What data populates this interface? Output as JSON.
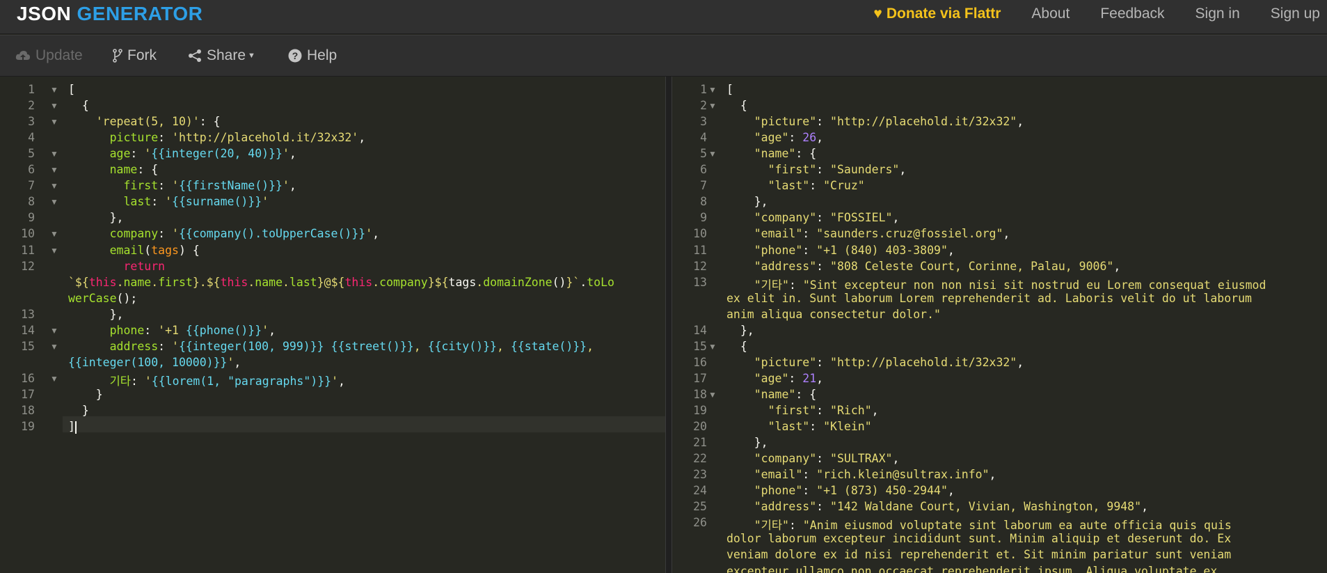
{
  "brand": {
    "part1": "JSON",
    "part2": "GENERATOR"
  },
  "nav": {
    "donate": "Donate via Flattr",
    "about": "About",
    "feedback": "Feedback",
    "signin": "Sign in",
    "signup": "Sign up"
  },
  "toolbar": {
    "update": "Update",
    "fork": "Fork",
    "share": "Share",
    "help": "Help"
  },
  "template_editor": {
    "lines": [
      {
        "n": "1",
        "fold": true,
        "tokens": [
          [
            "w",
            "["
          ]
        ]
      },
      {
        "n": "2",
        "fold": true,
        "tokens": [
          [
            "w",
            "  {"
          ]
        ]
      },
      {
        "n": "3",
        "fold": true,
        "tokens": [
          [
            "w",
            "    "
          ],
          [
            "s",
            "'repeat(5, 10)'"
          ],
          [
            "w",
            ": {"
          ]
        ]
      },
      {
        "n": "4",
        "fold": false,
        "tokens": [
          [
            "w",
            "      "
          ],
          [
            "k",
            "picture"
          ],
          [
            "w",
            ": "
          ],
          [
            "s",
            "'http://placehold.it/32x32'"
          ],
          [
            "w",
            ","
          ]
        ]
      },
      {
        "n": "5",
        "fold": true,
        "tokens": [
          [
            "w",
            "      "
          ],
          [
            "k",
            "age"
          ],
          [
            "w",
            ": "
          ],
          [
            "s",
            "'"
          ],
          [
            "t",
            "{{integer(20, 40)}}"
          ],
          [
            "s",
            "'"
          ],
          [
            "w",
            ","
          ]
        ]
      },
      {
        "n": "6",
        "fold": true,
        "tokens": [
          [
            "w",
            "      "
          ],
          [
            "k",
            "name"
          ],
          [
            "w",
            ": {"
          ]
        ]
      },
      {
        "n": "7",
        "fold": true,
        "tokens": [
          [
            "w",
            "        "
          ],
          [
            "k",
            "first"
          ],
          [
            "w",
            ": "
          ],
          [
            "s",
            "'"
          ],
          [
            "t",
            "{{firstName()}}"
          ],
          [
            "s",
            "'"
          ],
          [
            "w",
            ","
          ]
        ]
      },
      {
        "n": "8",
        "fold": true,
        "tokens": [
          [
            "w",
            "        "
          ],
          [
            "k",
            "last"
          ],
          [
            "w",
            ": "
          ],
          [
            "s",
            "'"
          ],
          [
            "t",
            "{{surname()}}"
          ],
          [
            "s",
            "'"
          ]
        ]
      },
      {
        "n": "9",
        "fold": false,
        "tokens": [
          [
            "w",
            "      },"
          ]
        ]
      },
      {
        "n": "10",
        "fold": true,
        "tokens": [
          [
            "w",
            "      "
          ],
          [
            "k",
            "company"
          ],
          [
            "w",
            ": "
          ],
          [
            "s",
            "'"
          ],
          [
            "t",
            "{{company().toUpperCase()}}"
          ],
          [
            "s",
            "'"
          ],
          [
            "w",
            ","
          ]
        ]
      },
      {
        "n": "11",
        "fold": true,
        "tokens": [
          [
            "w",
            "      "
          ],
          [
            "k",
            "email"
          ],
          [
            "w",
            "("
          ],
          [
            "p",
            "tags"
          ],
          [
            "w",
            ") {"
          ]
        ]
      },
      {
        "n": "12",
        "fold": false,
        "tokens": [
          [
            "w",
            "        "
          ],
          [
            "kw",
            "return"
          ]
        ]
      },
      {
        "n": "",
        "fold": false,
        "tokens": [
          [
            "s",
            "`${"
          ],
          [
            "kw",
            "this"
          ],
          [
            "s",
            "."
          ],
          [
            "k",
            "name"
          ],
          [
            "s",
            "."
          ],
          [
            "k",
            "first"
          ],
          [
            "s",
            "}.${"
          ],
          [
            "kw",
            "this"
          ],
          [
            "s",
            "."
          ],
          [
            "k",
            "name"
          ],
          [
            "s",
            "."
          ],
          [
            "k",
            "last"
          ],
          [
            "s",
            "}@${"
          ],
          [
            "kw",
            "this"
          ],
          [
            "s",
            "."
          ],
          [
            "k",
            "company"
          ],
          [
            "s",
            "}${"
          ],
          [
            "w",
            "tags"
          ],
          [
            "s",
            "."
          ],
          [
            "k",
            "domainZone"
          ],
          [
            "w",
            "()"
          ],
          [
            "s",
            "}`"
          ],
          [
            "w",
            "."
          ],
          [
            "k",
            "toLo"
          ]
        ]
      },
      {
        "n": "",
        "fold": false,
        "tokens": [
          [
            "k",
            "werCase"
          ],
          [
            "w",
            "();"
          ]
        ]
      },
      {
        "n": "13",
        "fold": false,
        "tokens": [
          [
            "w",
            "      },"
          ]
        ]
      },
      {
        "n": "14",
        "fold": true,
        "tokens": [
          [
            "w",
            "      "
          ],
          [
            "k",
            "phone"
          ],
          [
            "w",
            ": "
          ],
          [
            "s",
            "'+1 "
          ],
          [
            "t",
            "{{phone()}}"
          ],
          [
            "s",
            "'"
          ],
          [
            "w",
            ","
          ]
        ]
      },
      {
        "n": "15",
        "fold": true,
        "tokens": [
          [
            "w",
            "      "
          ],
          [
            "k",
            "address"
          ],
          [
            "w",
            ": "
          ],
          [
            "s",
            "'"
          ],
          [
            "t",
            "{{integer(100, 999)}}"
          ],
          [
            "s",
            " "
          ],
          [
            "t",
            "{{street()}}"
          ],
          [
            "s",
            ", "
          ],
          [
            "t",
            "{{city()}}"
          ],
          [
            "s",
            ", "
          ],
          [
            "t",
            "{{state()}}"
          ],
          [
            "s",
            ","
          ]
        ]
      },
      {
        "n": "",
        "fold": false,
        "tokens": [
          [
            "t",
            "{{integer(100, 10000)}}"
          ],
          [
            "s",
            "'"
          ],
          [
            "w",
            ","
          ]
        ]
      },
      {
        "n": "16",
        "fold": true,
        "tokens": [
          [
            "w",
            "      "
          ],
          [
            "k",
            "기타"
          ],
          [
            "w",
            ": "
          ],
          [
            "s",
            "'"
          ],
          [
            "t",
            "{{lorem(1, \"paragraphs\")}}"
          ],
          [
            "s",
            "'"
          ],
          [
            "w",
            ","
          ]
        ]
      },
      {
        "n": "17",
        "fold": false,
        "tokens": [
          [
            "w",
            "    }"
          ]
        ]
      },
      {
        "n": "18",
        "fold": false,
        "tokens": [
          [
            "w",
            "  }"
          ]
        ]
      },
      {
        "n": "19",
        "fold": false,
        "active": true,
        "tokens": [
          [
            "w",
            "]"
          ]
        ]
      }
    ]
  },
  "output_editor": {
    "lines": [
      {
        "n": "1",
        "fold": true,
        "tokens": [
          [
            "w",
            "["
          ]
        ]
      },
      {
        "n": "2",
        "fold": true,
        "tokens": [
          [
            "w",
            "  {"
          ]
        ]
      },
      {
        "n": "3",
        "fold": false,
        "tokens": [
          [
            "w",
            "    "
          ],
          [
            "s",
            "\"picture\""
          ],
          [
            "w",
            ": "
          ],
          [
            "s",
            "\"http://placehold.it/32x32\""
          ],
          [
            "w",
            ","
          ]
        ]
      },
      {
        "n": "4",
        "fold": false,
        "tokens": [
          [
            "w",
            "    "
          ],
          [
            "s",
            "\"age\""
          ],
          [
            "w",
            ": "
          ],
          [
            "n",
            "26"
          ],
          [
            "w",
            ","
          ]
        ]
      },
      {
        "n": "5",
        "fold": true,
        "tokens": [
          [
            "w",
            "    "
          ],
          [
            "s",
            "\"name\""
          ],
          [
            "w",
            ": {"
          ]
        ]
      },
      {
        "n": "6",
        "fold": false,
        "tokens": [
          [
            "w",
            "      "
          ],
          [
            "s",
            "\"first\""
          ],
          [
            "w",
            ": "
          ],
          [
            "s",
            "\"Saunders\""
          ],
          [
            "w",
            ","
          ]
        ]
      },
      {
        "n": "7",
        "fold": false,
        "tokens": [
          [
            "w",
            "      "
          ],
          [
            "s",
            "\"last\""
          ],
          [
            "w",
            ": "
          ],
          [
            "s",
            "\"Cruz\""
          ]
        ]
      },
      {
        "n": "8",
        "fold": false,
        "tokens": [
          [
            "w",
            "    },"
          ]
        ]
      },
      {
        "n": "9",
        "fold": false,
        "tokens": [
          [
            "w",
            "    "
          ],
          [
            "s",
            "\"company\""
          ],
          [
            "w",
            ": "
          ],
          [
            "s",
            "\"FOSSIEL\""
          ],
          [
            "w",
            ","
          ]
        ]
      },
      {
        "n": "10",
        "fold": false,
        "tokens": [
          [
            "w",
            "    "
          ],
          [
            "s",
            "\"email\""
          ],
          [
            "w",
            ": "
          ],
          [
            "s",
            "\"saunders.cruz@fossiel.org\""
          ],
          [
            "w",
            ","
          ]
        ]
      },
      {
        "n": "11",
        "fold": false,
        "tokens": [
          [
            "w",
            "    "
          ],
          [
            "s",
            "\"phone\""
          ],
          [
            "w",
            ": "
          ],
          [
            "s",
            "\"+1 (840) 403-3809\""
          ],
          [
            "w",
            ","
          ]
        ]
      },
      {
        "n": "12",
        "fold": false,
        "tokens": [
          [
            "w",
            "    "
          ],
          [
            "s",
            "\"address\""
          ],
          [
            "w",
            ": "
          ],
          [
            "s",
            "\"808 Celeste Court, Corinne, Palau, 9006\""
          ],
          [
            "w",
            ","
          ]
        ]
      },
      {
        "n": "13",
        "fold": false,
        "tokens": [
          [
            "w",
            "    "
          ],
          [
            "s",
            "\"기타\""
          ],
          [
            "w",
            ": "
          ],
          [
            "s",
            "\"Sint excepteur non non nisi sit nostrud eu Lorem consequat eiusmod"
          ]
        ]
      },
      {
        "n": "",
        "fold": false,
        "tokens": [
          [
            "s",
            "ex elit in. Sunt laborum Lorem reprehenderit ad. Laboris velit do ut laborum"
          ]
        ]
      },
      {
        "n": "",
        "fold": false,
        "tokens": [
          [
            "s",
            "anim aliqua consectetur dolor.\""
          ]
        ]
      },
      {
        "n": "14",
        "fold": false,
        "tokens": [
          [
            "w",
            "  },"
          ]
        ]
      },
      {
        "n": "15",
        "fold": true,
        "tokens": [
          [
            "w",
            "  {"
          ]
        ]
      },
      {
        "n": "16",
        "fold": false,
        "tokens": [
          [
            "w",
            "    "
          ],
          [
            "s",
            "\"picture\""
          ],
          [
            "w",
            ": "
          ],
          [
            "s",
            "\"http://placehold.it/32x32\""
          ],
          [
            "w",
            ","
          ]
        ]
      },
      {
        "n": "17",
        "fold": false,
        "tokens": [
          [
            "w",
            "    "
          ],
          [
            "s",
            "\"age\""
          ],
          [
            "w",
            ": "
          ],
          [
            "n",
            "21"
          ],
          [
            "w",
            ","
          ]
        ]
      },
      {
        "n": "18",
        "fold": true,
        "tokens": [
          [
            "w",
            "    "
          ],
          [
            "s",
            "\"name\""
          ],
          [
            "w",
            ": {"
          ]
        ]
      },
      {
        "n": "19",
        "fold": false,
        "tokens": [
          [
            "w",
            "      "
          ],
          [
            "s",
            "\"first\""
          ],
          [
            "w",
            ": "
          ],
          [
            "s",
            "\"Rich\""
          ],
          [
            "w",
            ","
          ]
        ]
      },
      {
        "n": "20",
        "fold": false,
        "tokens": [
          [
            "w",
            "      "
          ],
          [
            "s",
            "\"last\""
          ],
          [
            "w",
            ": "
          ],
          [
            "s",
            "\"Klein\""
          ]
        ]
      },
      {
        "n": "21",
        "fold": false,
        "tokens": [
          [
            "w",
            "    },"
          ]
        ]
      },
      {
        "n": "22",
        "fold": false,
        "tokens": [
          [
            "w",
            "    "
          ],
          [
            "s",
            "\"company\""
          ],
          [
            "w",
            ": "
          ],
          [
            "s",
            "\"SULTRAX\""
          ],
          [
            "w",
            ","
          ]
        ]
      },
      {
        "n": "23",
        "fold": false,
        "tokens": [
          [
            "w",
            "    "
          ],
          [
            "s",
            "\"email\""
          ],
          [
            "w",
            ": "
          ],
          [
            "s",
            "\"rich.klein@sultrax.info\""
          ],
          [
            "w",
            ","
          ]
        ]
      },
      {
        "n": "24",
        "fold": false,
        "tokens": [
          [
            "w",
            "    "
          ],
          [
            "s",
            "\"phone\""
          ],
          [
            "w",
            ": "
          ],
          [
            "s",
            "\"+1 (873) 450-2944\""
          ],
          [
            "w",
            ","
          ]
        ]
      },
      {
        "n": "25",
        "fold": false,
        "tokens": [
          [
            "w",
            "    "
          ],
          [
            "s",
            "\"address\""
          ],
          [
            "w",
            ": "
          ],
          [
            "s",
            "\"142 Waldane Court, Vivian, Washington, 9948\""
          ],
          [
            "w",
            ","
          ]
        ]
      },
      {
        "n": "26",
        "fold": false,
        "tokens": [
          [
            "w",
            "    "
          ],
          [
            "s",
            "\"기타\""
          ],
          [
            "w",
            ": "
          ],
          [
            "s",
            "\"Anim eiusmod voluptate sint laborum ea aute officia quis quis"
          ]
        ]
      },
      {
        "n": "",
        "fold": false,
        "tokens": [
          [
            "s",
            "dolor laborum excepteur incididunt sunt. Minim aliquip et deserunt do. Ex"
          ]
        ]
      },
      {
        "n": "",
        "fold": false,
        "tokens": [
          [
            "s",
            "veniam dolore ex id nisi reprehenderit et. Sit minim pariatur sunt veniam"
          ]
        ]
      },
      {
        "n": "",
        "fold": false,
        "tokens": [
          [
            "s",
            "excepteur ullamco non occaecat reprehenderit ipsum. Aliqua voluptate ex"
          ]
        ]
      }
    ]
  },
  "colors": {
    "brand_accent": "#2d9fe6",
    "donate": "#f4c21b",
    "editor_bg": "#272822"
  },
  "icons": {
    "update": "cloud-upload-icon",
    "fork": "fork-icon",
    "share": "share-icon",
    "help": "help-circle-icon",
    "donate": "heart-icon"
  }
}
